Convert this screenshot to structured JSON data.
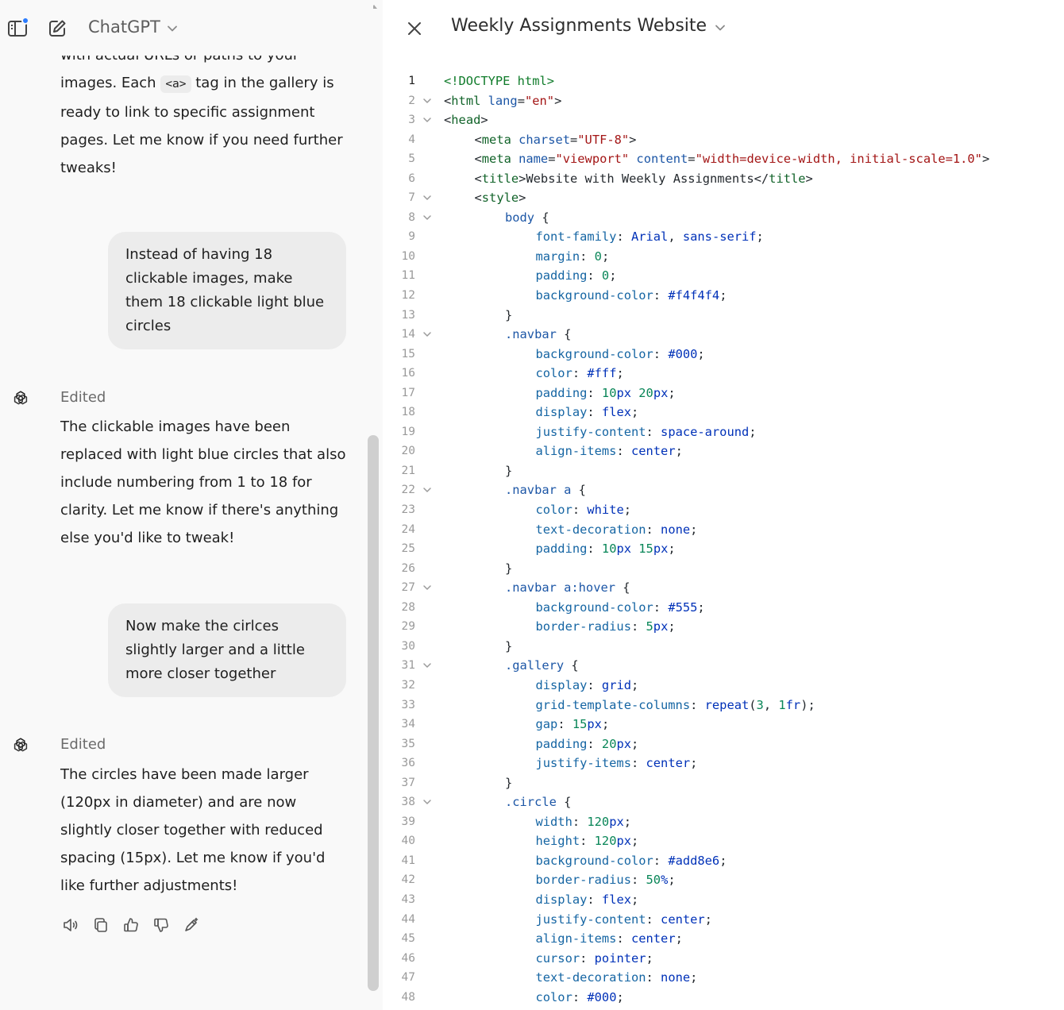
{
  "header": {
    "model_name": "ChatGPT",
    "icons": [
      "sidebar-toggle-icon",
      "new-chat-icon",
      "chevron-down-icon"
    ]
  },
  "chat": {
    "msg1_line0": "with actual URLs or paths to your",
    "msg1_pre": "images. Each ",
    "msg1_code": "<a>",
    "msg1_post": " tag in the gallery is",
    "msg1_rest": "ready to link to specific assignment pages. Let me know if you need further tweaks!",
    "user1": "Instead of having 18 clickable images, make them 18 clickable light blue circles",
    "edited1": "Edited",
    "reply1": "The clickable images have been replaced with light blue circles that also include numbering from 1 to 18 for clarity. Let me know if there's anything else you'd like to tweak!",
    "user2": "Now make the cirlces slightly larger and a little more closer together",
    "edited2": "Edited",
    "reply2": "The circles have been made larger (120px in diameter) and are now slightly closer together with reduced spacing (15px). Let me know if you'd like further adjustments!",
    "action_icons": [
      "read-aloud-icon",
      "copy-icon",
      "thumbs-up-icon",
      "thumbs-down-icon",
      "edit-in-canvas-icon"
    ]
  },
  "canvas": {
    "title": "Weekly Assignments Website",
    "colors": {
      "accent": "#2b7cff",
      "tag": "#116329",
      "attr": "#1c56a6",
      "string": "#a31515",
      "keyword": "#0031b8",
      "number": "#098658"
    },
    "lines": [
      {
        "n": "1",
        "fold": false,
        "indent": 0,
        "tokens": [
          [
            "t-green",
            "<!DOCTYPE html>"
          ]
        ]
      },
      {
        "n": "2",
        "fold": true,
        "indent": 0,
        "tokens": [
          [
            "t-punc",
            "<"
          ],
          [
            "t-tag",
            "html "
          ],
          [
            "t-attr",
            "lang"
          ],
          [
            "t-punc",
            "="
          ],
          [
            "t-str",
            "\"en\""
          ],
          [
            "t-punc",
            ">"
          ]
        ]
      },
      {
        "n": "3",
        "fold": true,
        "indent": 0,
        "tokens": [
          [
            "t-punc",
            "<"
          ],
          [
            "t-tag",
            "head"
          ],
          [
            "t-punc",
            ">"
          ]
        ]
      },
      {
        "n": "4",
        "fold": false,
        "indent": 1,
        "tokens": [
          [
            "t-punc",
            "<"
          ],
          [
            "t-tag",
            "meta "
          ],
          [
            "t-attr",
            "charset"
          ],
          [
            "t-punc",
            "="
          ],
          [
            "t-str",
            "\"UTF-8\""
          ],
          [
            "t-punc",
            ">"
          ]
        ]
      },
      {
        "n": "5",
        "fold": false,
        "indent": 1,
        "tokens": [
          [
            "t-punc",
            "<"
          ],
          [
            "t-tag",
            "meta "
          ],
          [
            "t-attr",
            "name"
          ],
          [
            "t-punc",
            "="
          ],
          [
            "t-str",
            "\"viewport\" "
          ],
          [
            "t-attr",
            "content"
          ],
          [
            "t-punc",
            "="
          ],
          [
            "t-str",
            "\"width=device-width, initial-scale=1.0\""
          ],
          [
            "t-punc",
            ">"
          ]
        ]
      },
      {
        "n": "6",
        "fold": false,
        "indent": 1,
        "tokens": [
          [
            "t-punc",
            "<"
          ],
          [
            "t-tag",
            "title"
          ],
          [
            "t-punc",
            ">Website with Weekly Assignments</"
          ],
          [
            "t-tag",
            "title"
          ],
          [
            "t-punc",
            ">"
          ]
        ]
      },
      {
        "n": "7",
        "fold": true,
        "indent": 1,
        "tokens": [
          [
            "t-punc",
            "<"
          ],
          [
            "t-tag",
            "style"
          ],
          [
            "t-punc",
            ">"
          ]
        ]
      },
      {
        "n": "8",
        "fold": true,
        "indent": 2,
        "tokens": [
          [
            "t-sel",
            "body"
          ],
          [
            "t-punc",
            " {"
          ]
        ]
      },
      {
        "n": "9",
        "fold": false,
        "indent": 3,
        "tokens": [
          [
            "t-prop",
            "font-family"
          ],
          [
            "t-punc",
            ": "
          ],
          [
            "t-kw",
            "Arial"
          ],
          [
            "t-punc",
            ", "
          ],
          [
            "t-kw",
            "sans-serif"
          ],
          [
            "t-punc",
            ";"
          ]
        ]
      },
      {
        "n": "10",
        "fold": false,
        "indent": 3,
        "tokens": [
          [
            "t-prop",
            "margin"
          ],
          [
            "t-punc",
            ": "
          ],
          [
            "t-num",
            "0"
          ],
          [
            "t-punc",
            ";"
          ]
        ]
      },
      {
        "n": "11",
        "fold": false,
        "indent": 3,
        "tokens": [
          [
            "t-prop",
            "padding"
          ],
          [
            "t-punc",
            ": "
          ],
          [
            "t-num",
            "0"
          ],
          [
            "t-punc",
            ";"
          ]
        ]
      },
      {
        "n": "12",
        "fold": false,
        "indent": 3,
        "tokens": [
          [
            "t-prop",
            "background-color"
          ],
          [
            "t-punc",
            ": "
          ],
          [
            "t-kw",
            "#f4f4f4"
          ],
          [
            "t-punc",
            ";"
          ]
        ]
      },
      {
        "n": "13",
        "fold": false,
        "indent": 2,
        "tokens": [
          [
            "t-punc",
            "}"
          ]
        ]
      },
      {
        "n": "14",
        "fold": true,
        "indent": 2,
        "tokens": [
          [
            "t-sel",
            ".navbar"
          ],
          [
            "t-punc",
            " {"
          ]
        ]
      },
      {
        "n": "15",
        "fold": false,
        "indent": 3,
        "tokens": [
          [
            "t-prop",
            "background-color"
          ],
          [
            "t-punc",
            ": "
          ],
          [
            "t-kw",
            "#000"
          ],
          [
            "t-punc",
            ";"
          ]
        ]
      },
      {
        "n": "16",
        "fold": false,
        "indent": 3,
        "tokens": [
          [
            "t-prop",
            "color"
          ],
          [
            "t-punc",
            ": "
          ],
          [
            "t-kw",
            "#fff"
          ],
          [
            "t-punc",
            ";"
          ]
        ]
      },
      {
        "n": "17",
        "fold": false,
        "indent": 3,
        "tokens": [
          [
            "t-prop",
            "padding"
          ],
          [
            "t-punc",
            ": "
          ],
          [
            "t-num",
            "10"
          ],
          [
            "t-kw",
            "px "
          ],
          [
            "t-num",
            "20"
          ],
          [
            "t-kw",
            "px"
          ],
          [
            "t-punc",
            ";"
          ]
        ]
      },
      {
        "n": "18",
        "fold": false,
        "indent": 3,
        "tokens": [
          [
            "t-prop",
            "display"
          ],
          [
            "t-punc",
            ": "
          ],
          [
            "t-kw",
            "flex"
          ],
          [
            "t-punc",
            ";"
          ]
        ]
      },
      {
        "n": "19",
        "fold": false,
        "indent": 3,
        "tokens": [
          [
            "t-prop",
            "justify-content"
          ],
          [
            "t-punc",
            ": "
          ],
          [
            "t-kw",
            "space-around"
          ],
          [
            "t-punc",
            ";"
          ]
        ]
      },
      {
        "n": "20",
        "fold": false,
        "indent": 3,
        "tokens": [
          [
            "t-prop",
            "align-items"
          ],
          [
            "t-punc",
            ": "
          ],
          [
            "t-kw",
            "center"
          ],
          [
            "t-punc",
            ";"
          ]
        ]
      },
      {
        "n": "21",
        "fold": false,
        "indent": 2,
        "tokens": [
          [
            "t-punc",
            "}"
          ]
        ]
      },
      {
        "n": "22",
        "fold": true,
        "indent": 2,
        "tokens": [
          [
            "t-sel",
            ".navbar a"
          ],
          [
            "t-punc",
            " {"
          ]
        ]
      },
      {
        "n": "23",
        "fold": false,
        "indent": 3,
        "tokens": [
          [
            "t-prop",
            "color"
          ],
          [
            "t-punc",
            ": "
          ],
          [
            "t-kw",
            "white"
          ],
          [
            "t-punc",
            ";"
          ]
        ]
      },
      {
        "n": "24",
        "fold": false,
        "indent": 3,
        "tokens": [
          [
            "t-prop",
            "text-decoration"
          ],
          [
            "t-punc",
            ": "
          ],
          [
            "t-kw",
            "none"
          ],
          [
            "t-punc",
            ";"
          ]
        ]
      },
      {
        "n": "25",
        "fold": false,
        "indent": 3,
        "tokens": [
          [
            "t-prop",
            "padding"
          ],
          [
            "t-punc",
            ": "
          ],
          [
            "t-num",
            "10"
          ],
          [
            "t-kw",
            "px "
          ],
          [
            "t-num",
            "15"
          ],
          [
            "t-kw",
            "px"
          ],
          [
            "t-punc",
            ";"
          ]
        ]
      },
      {
        "n": "26",
        "fold": false,
        "indent": 2,
        "tokens": [
          [
            "t-punc",
            "}"
          ]
        ]
      },
      {
        "n": "27",
        "fold": true,
        "indent": 2,
        "tokens": [
          [
            "t-sel",
            ".navbar a:hover"
          ],
          [
            "t-punc",
            " {"
          ]
        ]
      },
      {
        "n": "28",
        "fold": false,
        "indent": 3,
        "tokens": [
          [
            "t-prop",
            "background-color"
          ],
          [
            "t-punc",
            ": "
          ],
          [
            "t-kw",
            "#555"
          ],
          [
            "t-punc",
            ";"
          ]
        ]
      },
      {
        "n": "29",
        "fold": false,
        "indent": 3,
        "tokens": [
          [
            "t-prop",
            "border-radius"
          ],
          [
            "t-punc",
            ": "
          ],
          [
            "t-num",
            "5"
          ],
          [
            "t-kw",
            "px"
          ],
          [
            "t-punc",
            ";"
          ]
        ]
      },
      {
        "n": "30",
        "fold": false,
        "indent": 2,
        "tokens": [
          [
            "t-punc",
            "}"
          ]
        ]
      },
      {
        "n": "31",
        "fold": true,
        "indent": 2,
        "tokens": [
          [
            "t-sel",
            ".gallery"
          ],
          [
            "t-punc",
            " {"
          ]
        ]
      },
      {
        "n": "32",
        "fold": false,
        "indent": 3,
        "tokens": [
          [
            "t-prop",
            "display"
          ],
          [
            "t-punc",
            ": "
          ],
          [
            "t-kw",
            "grid"
          ],
          [
            "t-punc",
            ";"
          ]
        ]
      },
      {
        "n": "33",
        "fold": false,
        "indent": 3,
        "tokens": [
          [
            "t-prop",
            "grid-template-columns"
          ],
          [
            "t-punc",
            ": "
          ],
          [
            "t-kw",
            "repeat"
          ],
          [
            "t-punc",
            "("
          ],
          [
            "t-num",
            "3"
          ],
          [
            "t-punc",
            ", "
          ],
          [
            "t-num",
            "1"
          ],
          [
            "t-kw",
            "fr"
          ],
          [
            "t-punc",
            ");"
          ]
        ]
      },
      {
        "n": "34",
        "fold": false,
        "indent": 3,
        "tokens": [
          [
            "t-prop",
            "gap"
          ],
          [
            "t-punc",
            ": "
          ],
          [
            "t-num",
            "15"
          ],
          [
            "t-kw",
            "px"
          ],
          [
            "t-punc",
            ";"
          ]
        ]
      },
      {
        "n": "35",
        "fold": false,
        "indent": 3,
        "tokens": [
          [
            "t-prop",
            "padding"
          ],
          [
            "t-punc",
            ": "
          ],
          [
            "t-num",
            "20"
          ],
          [
            "t-kw",
            "px"
          ],
          [
            "t-punc",
            ";"
          ]
        ]
      },
      {
        "n": "36",
        "fold": false,
        "indent": 3,
        "tokens": [
          [
            "t-prop",
            "justify-items"
          ],
          [
            "t-punc",
            ": "
          ],
          [
            "t-kw",
            "center"
          ],
          [
            "t-punc",
            ";"
          ]
        ]
      },
      {
        "n": "37",
        "fold": false,
        "indent": 2,
        "tokens": [
          [
            "t-punc",
            "}"
          ]
        ]
      },
      {
        "n": "38",
        "fold": true,
        "indent": 2,
        "tokens": [
          [
            "t-sel",
            ".circle"
          ],
          [
            "t-punc",
            " {"
          ]
        ]
      },
      {
        "n": "39",
        "fold": false,
        "indent": 3,
        "tokens": [
          [
            "t-prop",
            "width"
          ],
          [
            "t-punc",
            ": "
          ],
          [
            "t-num",
            "120"
          ],
          [
            "t-kw",
            "px"
          ],
          [
            "t-punc",
            ";"
          ]
        ]
      },
      {
        "n": "40",
        "fold": false,
        "indent": 3,
        "tokens": [
          [
            "t-prop",
            "height"
          ],
          [
            "t-punc",
            ": "
          ],
          [
            "t-num",
            "120"
          ],
          [
            "t-kw",
            "px"
          ],
          [
            "t-punc",
            ";"
          ]
        ]
      },
      {
        "n": "41",
        "fold": false,
        "indent": 3,
        "tokens": [
          [
            "t-prop",
            "background-color"
          ],
          [
            "t-punc",
            ": "
          ],
          [
            "t-kw",
            "#add8e6"
          ],
          [
            "t-punc",
            ";"
          ]
        ]
      },
      {
        "n": "42",
        "fold": false,
        "indent": 3,
        "tokens": [
          [
            "t-prop",
            "border-radius"
          ],
          [
            "t-punc",
            ": "
          ],
          [
            "t-num",
            "50"
          ],
          [
            "t-kw",
            "%"
          ],
          [
            "t-punc",
            ";"
          ]
        ]
      },
      {
        "n": "43",
        "fold": false,
        "indent": 3,
        "tokens": [
          [
            "t-prop",
            "display"
          ],
          [
            "t-punc",
            ": "
          ],
          [
            "t-kw",
            "flex"
          ],
          [
            "t-punc",
            ";"
          ]
        ]
      },
      {
        "n": "44",
        "fold": false,
        "indent": 3,
        "tokens": [
          [
            "t-prop",
            "justify-content"
          ],
          [
            "t-punc",
            ": "
          ],
          [
            "t-kw",
            "center"
          ],
          [
            "t-punc",
            ";"
          ]
        ]
      },
      {
        "n": "45",
        "fold": false,
        "indent": 3,
        "tokens": [
          [
            "t-prop",
            "align-items"
          ],
          [
            "t-punc",
            ": "
          ],
          [
            "t-kw",
            "center"
          ],
          [
            "t-punc",
            ";"
          ]
        ]
      },
      {
        "n": "46",
        "fold": false,
        "indent": 3,
        "tokens": [
          [
            "t-prop",
            "cursor"
          ],
          [
            "t-punc",
            ": "
          ],
          [
            "t-kw",
            "pointer"
          ],
          [
            "t-punc",
            ";"
          ]
        ]
      },
      {
        "n": "47",
        "fold": false,
        "indent": 3,
        "tokens": [
          [
            "t-prop",
            "text-decoration"
          ],
          [
            "t-punc",
            ": "
          ],
          [
            "t-kw",
            "none"
          ],
          [
            "t-punc",
            ";"
          ]
        ]
      },
      {
        "n": "48",
        "fold": false,
        "indent": 3,
        "tokens": [
          [
            "t-prop",
            "color"
          ],
          [
            "t-punc",
            ": "
          ],
          [
            "t-kw",
            "#000"
          ],
          [
            "t-punc",
            ";"
          ]
        ]
      }
    ]
  }
}
